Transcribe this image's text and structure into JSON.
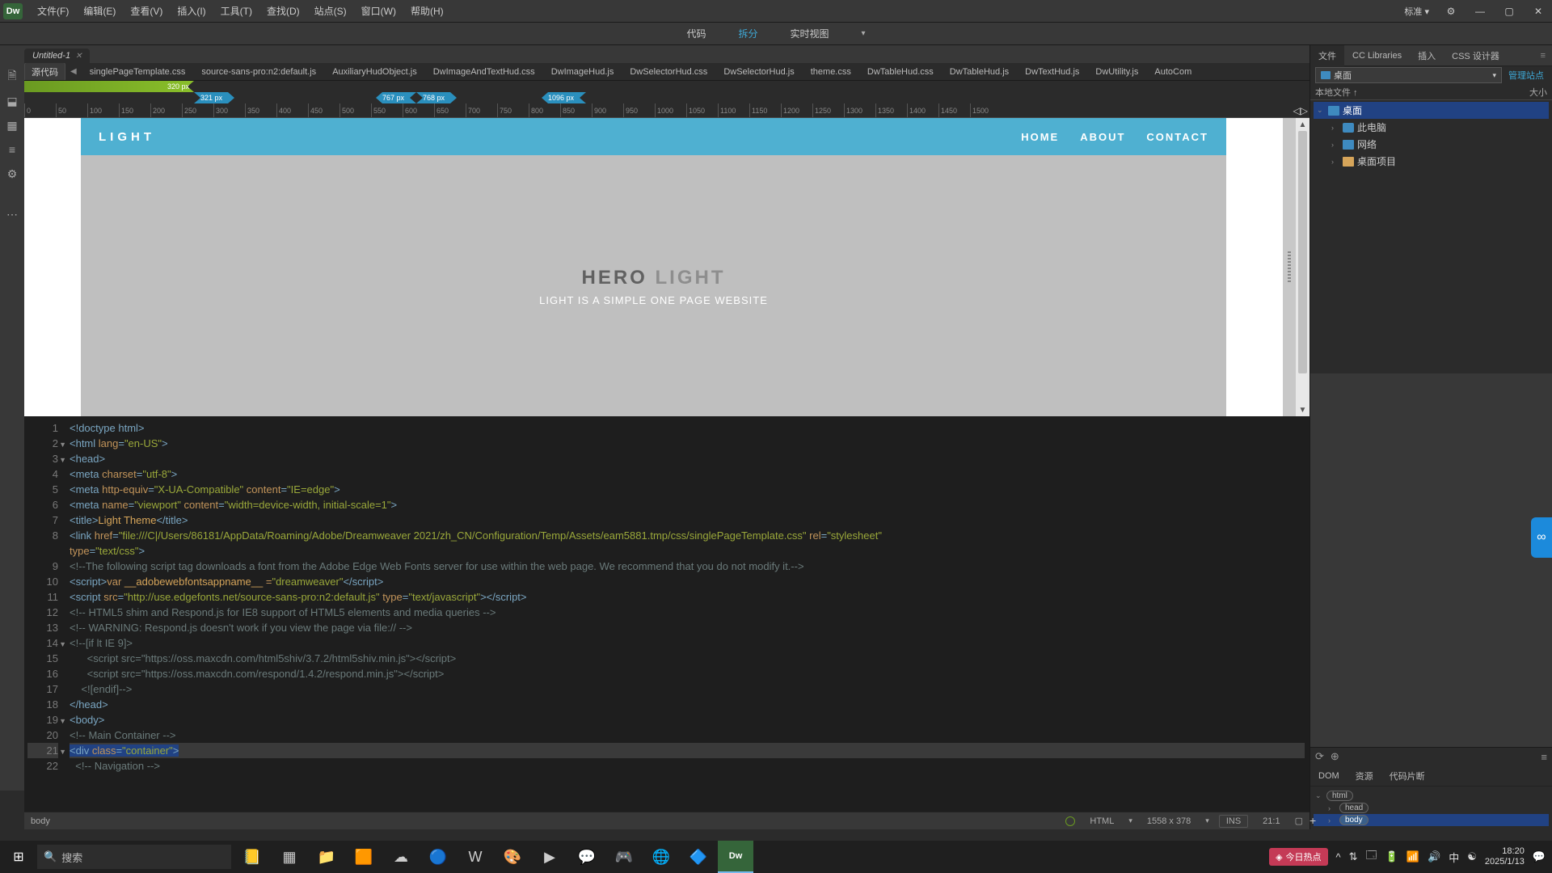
{
  "titlebar": {
    "logo": "Dw",
    "menus": [
      "文件(F)",
      "编辑(E)",
      "查看(V)",
      "插入(I)",
      "工具(T)",
      "查找(D)",
      "站点(S)",
      "窗口(W)",
      "帮助(H)"
    ],
    "layout_label": "标准 ▾"
  },
  "viewswitch": {
    "code": "代码",
    "split": "拆分",
    "live": "实时视图"
  },
  "doctab": {
    "title": "Untitled-1"
  },
  "relfiles": {
    "source": "源代码",
    "files": [
      "singlePageTemplate.css",
      "source-sans-pro:n2:default.js",
      "AuxiliaryHudObject.js",
      "DwImageAndTextHud.css",
      "DwImageHud.js",
      "DwSelectorHud.css",
      "DwSelectorHud.js",
      "theme.css",
      "DwTableHud.css",
      "DwTableHud.js",
      "DwTextHud.js",
      "DwUtility.js",
      "AutoCom"
    ]
  },
  "breakpoints": {
    "green": "320  px",
    "m1a": "321  px",
    "m1b": "767  px",
    "m2a": "768  px",
    "m2b": "1096  px"
  },
  "ruler": {
    "ticks": [
      0,
      50,
      100,
      150,
      200,
      250,
      300,
      350,
      400,
      450,
      500,
      550,
      600,
      650,
      700,
      750,
      800,
      850,
      900,
      950,
      1000,
      1050,
      1100,
      1150,
      1200,
      1250,
      1300,
      1350,
      1400,
      1450,
      1500
    ]
  },
  "preview": {
    "brand": "LIGHT",
    "nav": [
      "HOME",
      "ABOUT",
      "CONTACT"
    ],
    "hero_dark": "HERO",
    "hero_lite": "LIGHT",
    "hero_sub": "LIGHT IS A SIMPLE ONE PAGE WEBSITE"
  },
  "code": {
    "lines": [
      {
        "n": 1,
        "t": "<!doctype html>",
        "k": "tag"
      },
      {
        "n": 2,
        "fold": true,
        "seg": [
          [
            "<",
            "tag"
          ],
          [
            "html ",
            "tag"
          ],
          [
            "lang",
            "attr"
          ],
          [
            "=",
            "tag"
          ],
          [
            "\"en-US\"",
            "str"
          ],
          [
            ">",
            "tag"
          ]
        ]
      },
      {
        "n": 3,
        "fold": true,
        "seg": [
          [
            "<head>",
            "tag"
          ]
        ]
      },
      {
        "n": 4,
        "seg": [
          [
            "<meta ",
            "tag"
          ],
          [
            "charset",
            "attr"
          ],
          [
            "=",
            "tag"
          ],
          [
            "\"utf-8\"",
            "str"
          ],
          [
            ">",
            "tag"
          ]
        ]
      },
      {
        "n": 5,
        "seg": [
          [
            "<meta ",
            "tag"
          ],
          [
            "http-equiv",
            "attr"
          ],
          [
            "=",
            "tag"
          ],
          [
            "\"X-UA-Compatible\" ",
            "str"
          ],
          [
            "content",
            "attr"
          ],
          [
            "=",
            "tag"
          ],
          [
            "\"IE=edge\"",
            "str"
          ],
          [
            ">",
            "tag"
          ]
        ]
      },
      {
        "n": 6,
        "seg": [
          [
            "<meta ",
            "tag"
          ],
          [
            "name",
            "attr"
          ],
          [
            "=",
            "tag"
          ],
          [
            "\"viewport\" ",
            "str"
          ],
          [
            "content",
            "attr"
          ],
          [
            "=",
            "tag"
          ],
          [
            "\"width=device-width, initial-scale=1\"",
            "str"
          ],
          [
            ">",
            "tag"
          ]
        ]
      },
      {
        "n": 7,
        "seg": [
          [
            "<title>",
            "tag"
          ],
          [
            "Light Theme",
            "txt"
          ],
          [
            "</title>",
            "tag"
          ]
        ]
      },
      {
        "n": 8,
        "seg": [
          [
            "<link ",
            "tag"
          ],
          [
            "href",
            "attr"
          ],
          [
            "=",
            "tag"
          ],
          [
            "\"file:///C|/Users/86181/AppData/Roaming/Adobe/Dreamweaver 2021/zh_CN/Configuration/Temp/Assets/eam5881.tmp/css/singlePageTemplate.css\" ",
            "str"
          ],
          [
            "rel",
            "attr"
          ],
          [
            "=",
            "tag"
          ],
          [
            "\"stylesheet\" ",
            "str"
          ]
        ]
      },
      {
        "n": "",
        "seg": [
          [
            "type",
            "attr"
          ],
          [
            "=",
            "tag"
          ],
          [
            "\"text/css\"",
            "str"
          ],
          [
            ">",
            "tag"
          ]
        ]
      },
      {
        "n": 9,
        "seg": [
          [
            "<!--The following script tag downloads a font from the Adobe Edge Web Fonts server for use within the web page. We recommend that you do not modify it.-->",
            "cmt"
          ]
        ]
      },
      {
        "n": 10,
        "seg": [
          [
            "<script>",
            "tag"
          ],
          [
            "var ",
            "attr"
          ],
          [
            "__adobewebfontsappname__",
            "txt"
          ],
          [
            " =",
            "attr"
          ],
          [
            "\"dreamweaver\"",
            "str"
          ],
          [
            "</script>",
            "tag"
          ]
        ]
      },
      {
        "n": 11,
        "seg": [
          [
            "<script ",
            "tag"
          ],
          [
            "src",
            "attr"
          ],
          [
            "=",
            "tag"
          ],
          [
            "\"http://use.edgefonts.net/source-sans-pro:n2:default.js\" ",
            "str"
          ],
          [
            "type",
            "attr"
          ],
          [
            "=",
            "tag"
          ],
          [
            "\"text/javascript\"",
            "str"
          ],
          [
            "></script>",
            "tag"
          ]
        ]
      },
      {
        "n": 12,
        "seg": [
          [
            "<!-- HTML5 shim and Respond.js for IE8 support of HTML5 elements and media queries -->",
            "cmt"
          ]
        ]
      },
      {
        "n": 13,
        "seg": [
          [
            "<!-- WARNING: Respond.js doesn't work if you view the page via file:// -->",
            "cmt"
          ]
        ]
      },
      {
        "n": 14,
        "fold": true,
        "seg": [
          [
            "<!--[if lt IE 9]>",
            "cmt"
          ]
        ]
      },
      {
        "n": 15,
        "seg": [
          [
            "      <script src=\"https://oss.maxcdn.com/html5shiv/3.7.2/html5shiv.min.js\"></script>",
            "cmt"
          ]
        ]
      },
      {
        "n": 16,
        "seg": [
          [
            "      <script src=\"https://oss.maxcdn.com/respond/1.4.2/respond.min.js\"></script>",
            "cmt"
          ]
        ]
      },
      {
        "n": 17,
        "seg": [
          [
            "    <![endif]-->",
            "cmt"
          ]
        ]
      },
      {
        "n": 18,
        "seg": [
          [
            "</head>",
            "tag"
          ]
        ]
      },
      {
        "n": 19,
        "fold": true,
        "seg": [
          [
            "<body>",
            "tag"
          ]
        ]
      },
      {
        "n": 20,
        "seg": [
          [
            "<!-- Main Container -->",
            "cmt"
          ]
        ]
      },
      {
        "n": 21,
        "fold": true,
        "hl": true,
        "seg": [
          [
            "<div ",
            "tag",
            "sel"
          ],
          [
            "class",
            "attr",
            "sel"
          ],
          [
            "=",
            "tag",
            "sel"
          ],
          [
            "\"container\"",
            "str",
            "sel"
          ],
          [
            ">",
            "tag",
            "sel"
          ]
        ]
      },
      {
        "n": 22,
        "seg": [
          [
            "  <!-- Navigation -->",
            "cmt"
          ]
        ]
      }
    ]
  },
  "statusbar": {
    "path": "body",
    "lang": "HTML",
    "dims": "1558 x 378",
    "ins": "INS",
    "pos": "21:1"
  },
  "rightpanels": {
    "files_tabs": [
      "文件",
      "CC Libraries",
      "插入",
      "CSS 设计器"
    ],
    "site_dropdown": "桌面",
    "manage": "管理站点",
    "cols": [
      "本地文件 ↑",
      "大小"
    ],
    "tree": [
      {
        "depth": 0,
        "open": true,
        "icon": "blue",
        "label": "桌面",
        "sel": true
      },
      {
        "depth": 1,
        "open": false,
        "icon": "computer",
        "label": "此电脑"
      },
      {
        "depth": 1,
        "open": false,
        "icon": "blue",
        "label": "网络"
      },
      {
        "depth": 1,
        "open": false,
        "icon": "folder",
        "label": "桌面项目"
      }
    ],
    "dom_tabs": [
      "DOM",
      "资源",
      "代码片断"
    ],
    "dom_tree": [
      {
        "depth": 0,
        "open": true,
        "tag": "html"
      },
      {
        "depth": 1,
        "open": false,
        "tag": "head"
      },
      {
        "depth": 1,
        "open": false,
        "tag": "body",
        "sel": true
      }
    ]
  },
  "taskbar": {
    "search_placeholder": "搜索",
    "news": "今日热点",
    "time": "18:20",
    "date": "2025/1/13"
  }
}
